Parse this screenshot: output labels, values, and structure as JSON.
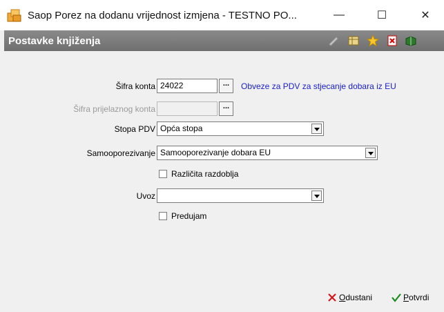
{
  "window": {
    "title": "Saop Porez na dodanu vrijednost izmjena  - TESTNO PO...",
    "controls": {
      "minimize": "—",
      "maximize": "☐",
      "close": "✕"
    }
  },
  "header": {
    "title": "Postavke knjiženja",
    "toolbar_icons": [
      "pencil-icon",
      "columns-icon",
      "star-icon",
      "delete-icon",
      "book-icon"
    ]
  },
  "form": {
    "sifra_konta": {
      "label": "Šifra konta",
      "value": "24022",
      "description": "Obveze za PDV za stjecanje dobara iz EU"
    },
    "sifra_prijelaznog_konta": {
      "label": "Šifra prijelaznog konta",
      "value": ""
    },
    "stopa_pdv": {
      "label": "Stopa PDV",
      "value": "Opća stopa"
    },
    "samooporezivanje": {
      "label": "Samooporezivanje",
      "value": "Samooporezivanje dobara EU"
    },
    "razlicita_razdoblja": {
      "label": "Različita razdoblja",
      "checked": false
    },
    "uvoz": {
      "label": "Uvoz",
      "value": ""
    },
    "predujam": {
      "label": "Predujam",
      "checked": false
    },
    "ellipsis": "..."
  },
  "footer": {
    "cancel": {
      "hotkey": "O",
      "rest": "dustani"
    },
    "confirm": {
      "hotkey": "P",
      "rest": "otvrdi"
    }
  }
}
